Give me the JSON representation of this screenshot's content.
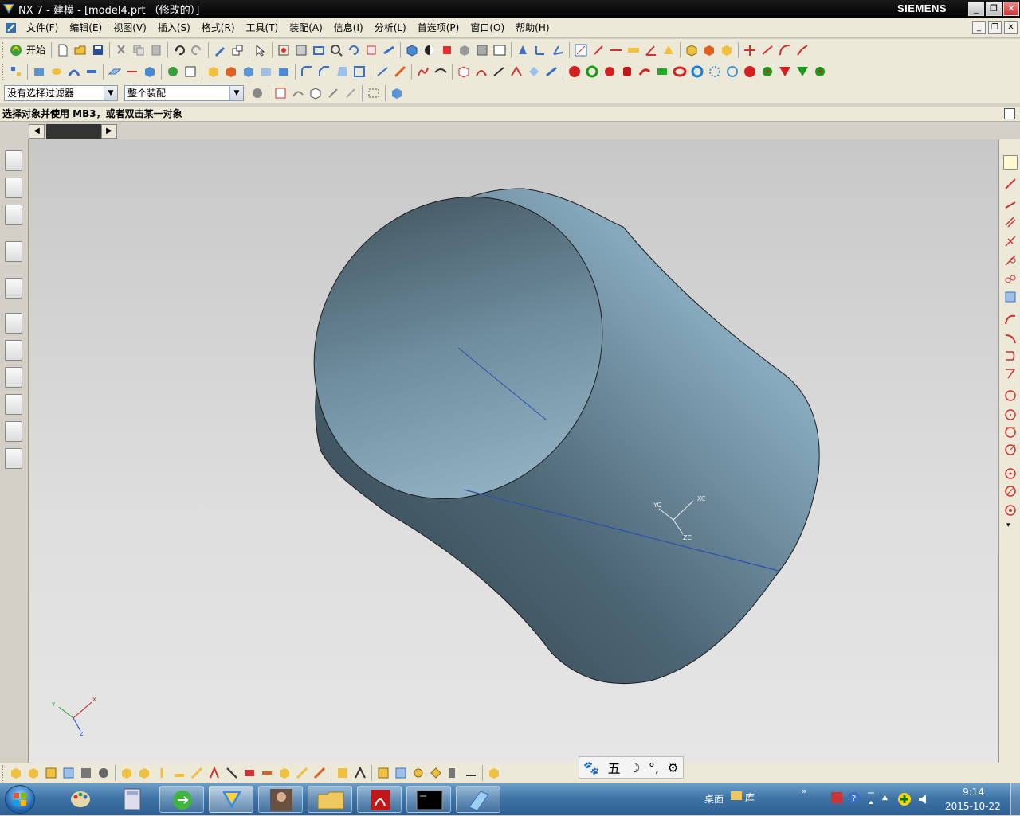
{
  "window": {
    "title": "NX 7 - 建模 - [model4.prt （修改的）]",
    "brand": "SIEMENS"
  },
  "menu": {
    "items": [
      "文件(F)",
      "编辑(E)",
      "视图(V)",
      "插入(S)",
      "格式(R)",
      "工具(T)",
      "装配(A)",
      "信息(I)",
      "分析(L)",
      "首选项(P)",
      "窗口(O)",
      "帮助(H)"
    ]
  },
  "toolbar": {
    "start_label": "开始"
  },
  "selection": {
    "filter_value": "没有选择过滤器",
    "scope_value": "整个装配"
  },
  "cue_line": "选择对象并使用 MB3，或者双击某一对象",
  "viewport": {
    "wcs_labels": {
      "xc": "XC",
      "yc": "YC",
      "zc": "ZC"
    },
    "triad_labels": {
      "x": "X",
      "y": "Y",
      "z": "Z"
    },
    "colors": {
      "surface_light": "#9ab9cc",
      "surface_dark": "#2f3d46",
      "edge": "#1a1a1a",
      "axis_line": "#2850b4"
    }
  },
  "ime_bar": {
    "items": [
      "🐾",
      "五",
      "☽",
      "°,",
      "⚙"
    ]
  },
  "taskbar": {
    "desktop_label": "桌面",
    "library_label": "库",
    "time": "9:14",
    "date": "2015-10-22"
  }
}
